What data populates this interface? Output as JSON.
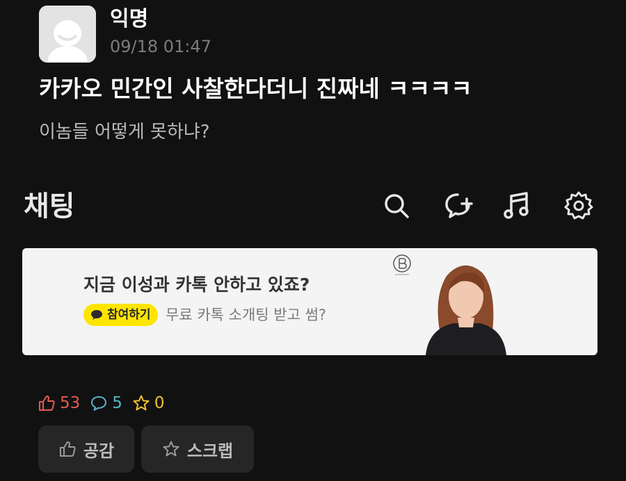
{
  "post": {
    "author": "익명",
    "timestamp": "09/18 01:47",
    "title": "카카오 민간인 사찰한다더니 진짜네 ㅋㅋㅋㅋ",
    "body": "이놈들 어떻게 못하냐?"
  },
  "embedded_screenshot": {
    "title": "채팅",
    "toolbar_icons": [
      "search-icon",
      "new-chat-icon",
      "music-icon",
      "settings-icon"
    ],
    "ad": {
      "headline": "지금 이성과 카톡 안하고 있죠?",
      "cta_label": "참여하기",
      "subtext": "무료 카톡 소개팅 받고 썸?",
      "cta_color": "#fde500"
    }
  },
  "stats": {
    "likes": "53",
    "comments": "5",
    "scraps": "0",
    "likes_color": "#e35d50",
    "comments_color": "#58b6c8",
    "scraps_color": "#f2c12e"
  },
  "actions": {
    "like_label": "공감",
    "scrap_label": "스크랩"
  }
}
